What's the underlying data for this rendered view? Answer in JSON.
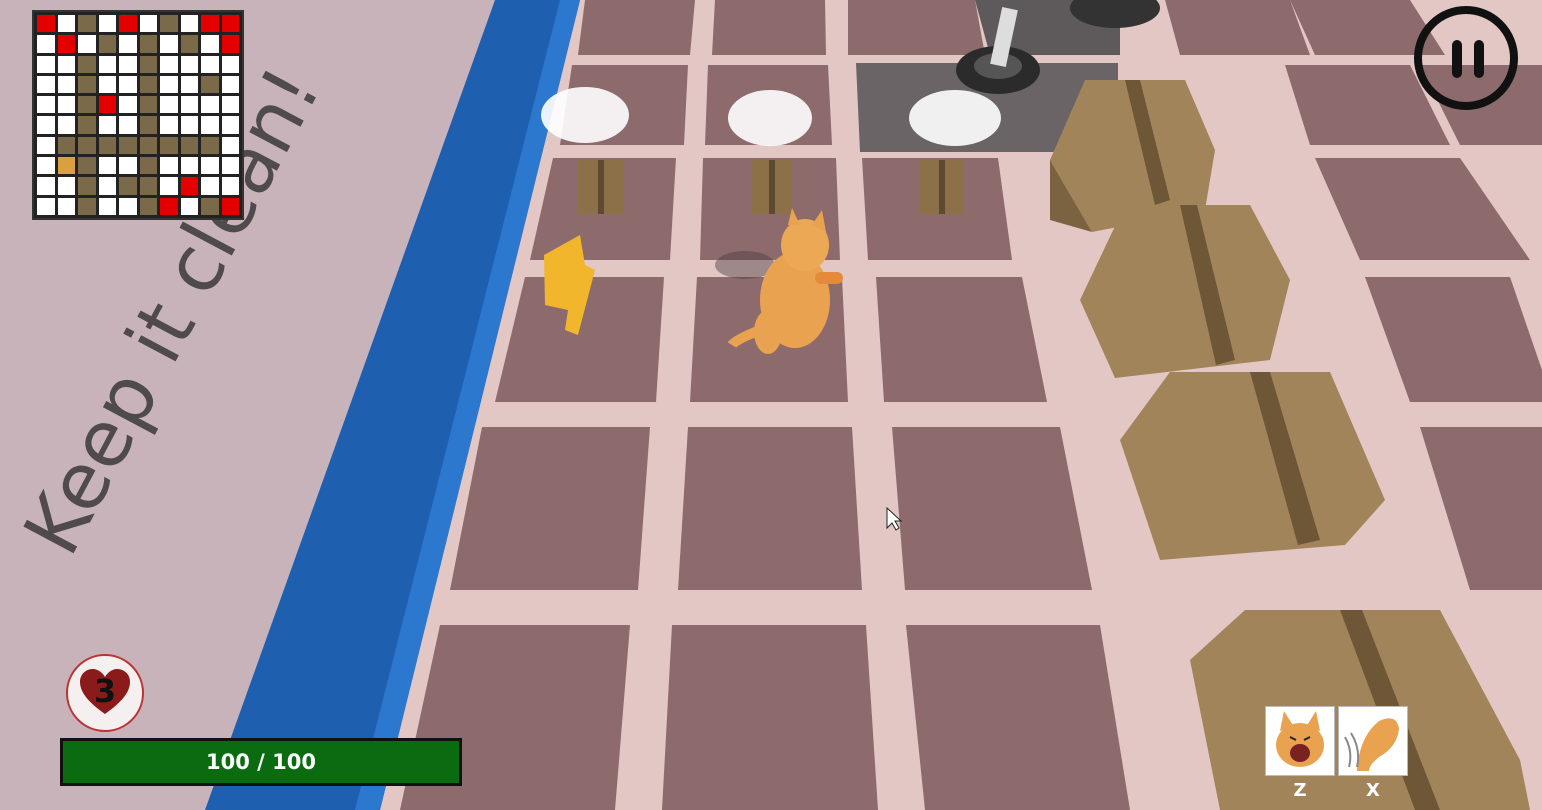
{
  "minimap": {
    "palette": {
      "e": "#ffffff",
      "w": "#7a6a4a",
      "r": "#e50000",
      "p": "#d9a040"
    },
    "rows": [
      "rewerewerr",
      "erewewewer",
      "eeweeweeee",
      "eeweeweewe",
      "eewreweeee",
      "eeweeweeee",
      "ewwwwwwwwe",
      "epweeweeee",
      "eewewweree",
      "eeweewrewr"
    ]
  },
  "hud": {
    "lives": "3",
    "health_text": "100 / 100",
    "health_fraction": 1.0
  },
  "abilities": [
    {
      "key": "Z",
      "icon": "cat-roar-icon"
    },
    {
      "key": "X",
      "icon": "cat-claw-icon"
    }
  ],
  "floor_text": "Keep it clean!",
  "colors": {
    "tile": "#8d6b6d",
    "grout": "#e2c7c5",
    "wall": "#1f5fb0",
    "floor": "#c9b3bb",
    "health": "#0a6b10",
    "cat": "#e9a24f",
    "box": "#a2845a"
  }
}
